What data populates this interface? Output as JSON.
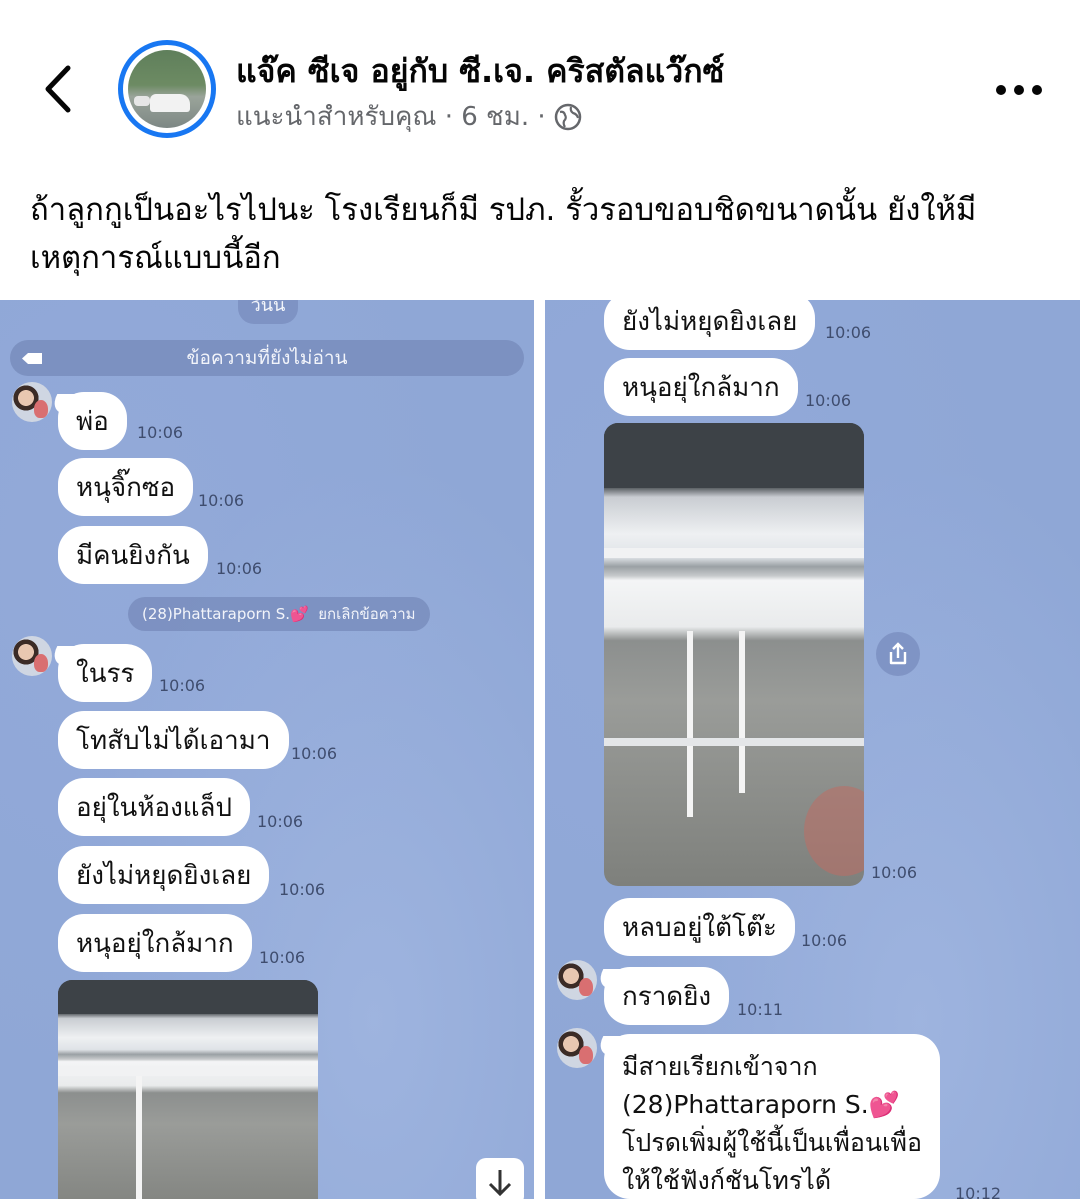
{
  "header": {
    "page_name": "แจ๊ค ซีเจ อยู่กับ ซี.เจ. คริสตัลแว๊กซ์",
    "subtitle": "แนะนำสำหรับคุณ · 6 ชม. ·",
    "icons": [
      "chevron-left-icon",
      "globe-icon",
      "more-icon"
    ]
  },
  "post": {
    "text": "ถ้าลูกกูเป็นอะไรไปนะ โรงเรียนก็มี รปภ. รั้วรอบขอบชิดขนาดนั้น ยังให้มีเหตุการณ์แบบนี้อีก"
  },
  "left_chat": {
    "date_pill": "วันนี้",
    "unread": "ข้อความที่ยังไม่อ่าน",
    "messages": [
      {
        "text": "พ่อ",
        "time": "10:06"
      },
      {
        "text": "หนุจิ๊กซอ",
        "time": "10:06"
      },
      {
        "text": "มีคนยิงกัน",
        "time": "10:06"
      },
      {
        "text": "ในรร",
        "time": "10:06"
      },
      {
        "text": "โทสับไม่ได้เอามา",
        "time": "10:06"
      },
      {
        "text": "อยุ่ในห้องแล็ป",
        "time": "10:06"
      },
      {
        "text": "ยังไม่หยุดยิงเลย",
        "time": "10:06"
      },
      {
        "text": "หนุอยุ่ใกล้มาก",
        "time": "10:06"
      }
    ],
    "system_msg": {
      "name": "(28)Phattaraporn S.",
      "heart": "💕",
      "action": "ยกเลิกข้อความ"
    }
  },
  "right_chat": {
    "messages": [
      {
        "text": "ยังไม่หยุดยิงเลย",
        "time": "10:06"
      },
      {
        "text": "หนุอยุ่ใกล้มาก",
        "time": "10:06"
      },
      {
        "text": "หลบอยู่ใต้โต๊ะ",
        "time": "10:06"
      },
      {
        "text": "กราดยิง",
        "time": "10:11"
      }
    ],
    "photo_time": "10:06",
    "call_msg": {
      "line1": "มีสายเรียกเข้าจาก",
      "line2": "(28)Phattaraporn S.",
      "heart": "💕",
      "line3": "โปรดเพิ่มผู้ใช้นี้เป็นเพื่อนเพื่อ",
      "line4": "ให้ใช้ฟังก์ชันโทรได้",
      "time": "10:12"
    }
  }
}
